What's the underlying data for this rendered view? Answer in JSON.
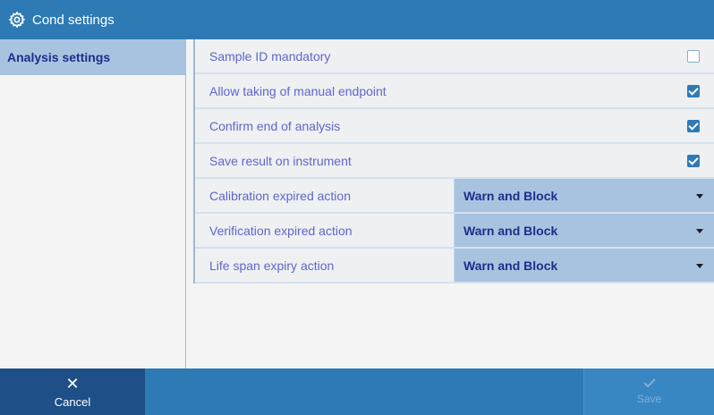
{
  "window": {
    "title": "Cond settings",
    "icon": "gear-icon"
  },
  "sidebar": {
    "items": [
      {
        "label": "Analysis settings",
        "selected": true
      }
    ]
  },
  "settings": {
    "checkbox_rows": [
      {
        "label": "Sample ID mandatory",
        "checked": false
      },
      {
        "label": "Allow taking of manual endpoint",
        "checked": true
      },
      {
        "label": "Confirm end of analysis",
        "checked": true
      },
      {
        "label": "Save result on instrument",
        "checked": true
      }
    ],
    "select_rows": [
      {
        "label": "Calibration expired action",
        "value": "Warn and Block"
      },
      {
        "label": "Verification expired action",
        "value": "Warn and Block"
      },
      {
        "label": "Life span expiry action",
        "value": "Warn and Block"
      }
    ]
  },
  "footer": {
    "cancel_label": "Cancel",
    "save_label": "Save",
    "save_enabled": false
  },
  "colors": {
    "titlebar": "#2e7ab5",
    "selected": "#a8c3e0",
    "label_text": "#6066c8",
    "value_text": "#1c2e8a",
    "cancel_bg": "#1e4f86"
  }
}
